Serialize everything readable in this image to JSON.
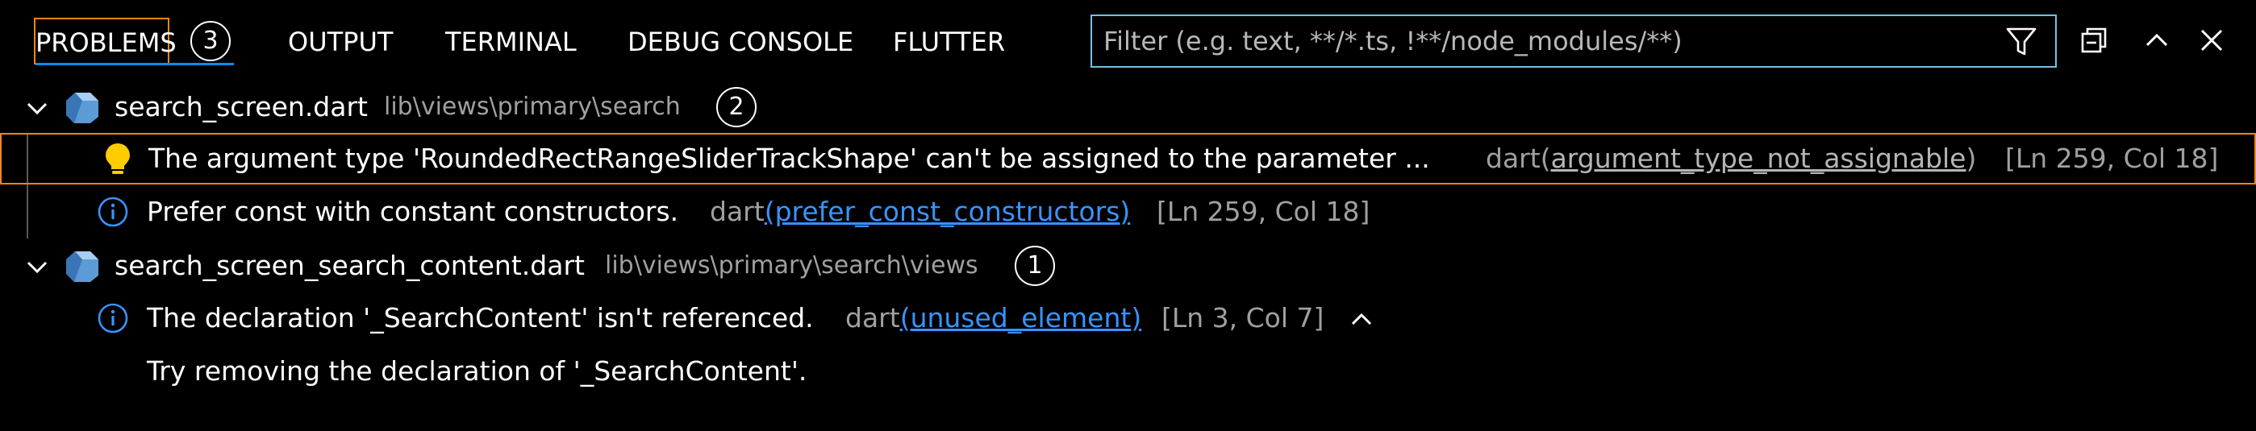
{
  "tabs": [
    {
      "label": "PROBLEMS",
      "badge": "3"
    },
    {
      "label": "OUTPUT"
    },
    {
      "label": "TERMINAL"
    },
    {
      "label": "DEBUG CONSOLE"
    },
    {
      "label": "FLUTTER"
    }
  ],
  "filter": {
    "placeholder": "Filter (e.g. text, **/*.ts, !**/node_modules/**)",
    "value": ""
  },
  "actions": [
    "collapse-all-icon",
    "maximize-panel-icon",
    "close-panel-icon"
  ],
  "files": [
    {
      "name": "search_screen.dart",
      "path": "lib\\views\\primary\\search",
      "count": "2",
      "problems": [
        {
          "severity": "warning",
          "icon": "lightbulb-icon",
          "message": "The argument type 'RoundedRectRangeSliderTrackShape' can't be assigned to the parameter ...",
          "source": "dart",
          "code": "argument_type_not_assignable",
          "location": "[Ln 259, Col 18]"
        },
        {
          "severity": "info",
          "icon": "info-icon",
          "message": "Prefer const with constant constructors.",
          "source": "dart",
          "code": "prefer_const_constructors",
          "location": "[Ln 259, Col 18]"
        }
      ]
    },
    {
      "name": "search_screen_search_content.dart",
      "path": "lib\\views\\primary\\search\\views",
      "count": "1",
      "problems": [
        {
          "severity": "info",
          "icon": "info-icon",
          "message": "The declaration '_SearchContent' isn't referenced.",
          "source": "dart",
          "code": "unused_element",
          "location": "[Ln 3, Col 7]",
          "detail": "Try removing the declaration of '_SearchContent'."
        }
      ]
    }
  ],
  "colors": {
    "background": "#000000",
    "focus_border": "#f38518",
    "link": "#3794ff",
    "filter_border": "#6fc3df",
    "info": "#3794ff",
    "warning": "#ffcc00"
  }
}
